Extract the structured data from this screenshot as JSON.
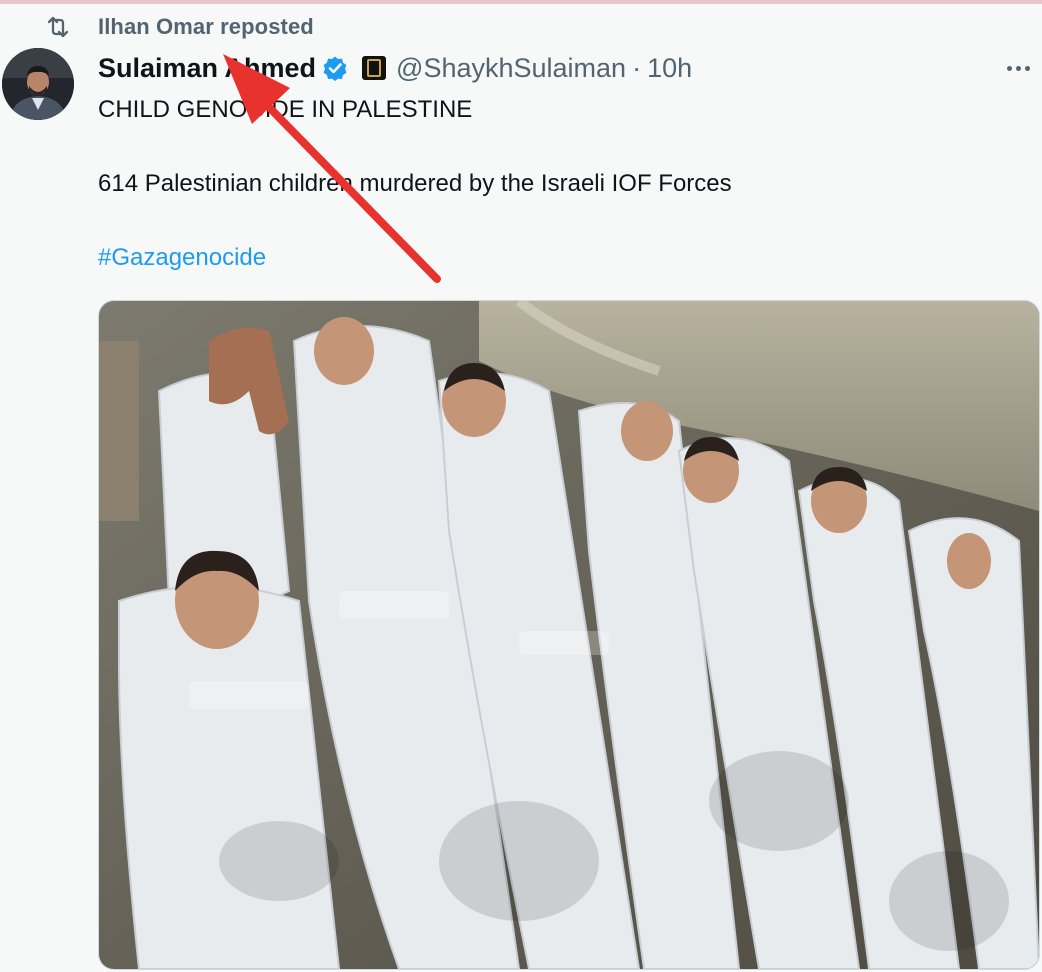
{
  "repost": {
    "label": "Ilhan Omar reposted",
    "icon": "repost-icon"
  },
  "author": {
    "display_name": "Sulaiman Ahmed",
    "handle": "@ShaykhSulaiman",
    "separator": "·",
    "timestamp": "10h",
    "verified_color": "#1d9bf0"
  },
  "tweet": {
    "line1": "CHILD GENOCIDE IN PALESTINE",
    "line2": "614 Palestinian children murdered by the Israeli IOF Forces",
    "hashtag": "#Gazagenocide"
  },
  "media": {
    "type": "photo"
  },
  "annotation": {
    "color": "#e8322d",
    "shape": "arrow"
  },
  "colors": {
    "text": "#0f1419",
    "secondary": "#536471",
    "link": "#1d9bf0",
    "background": "#f7f9f9"
  }
}
